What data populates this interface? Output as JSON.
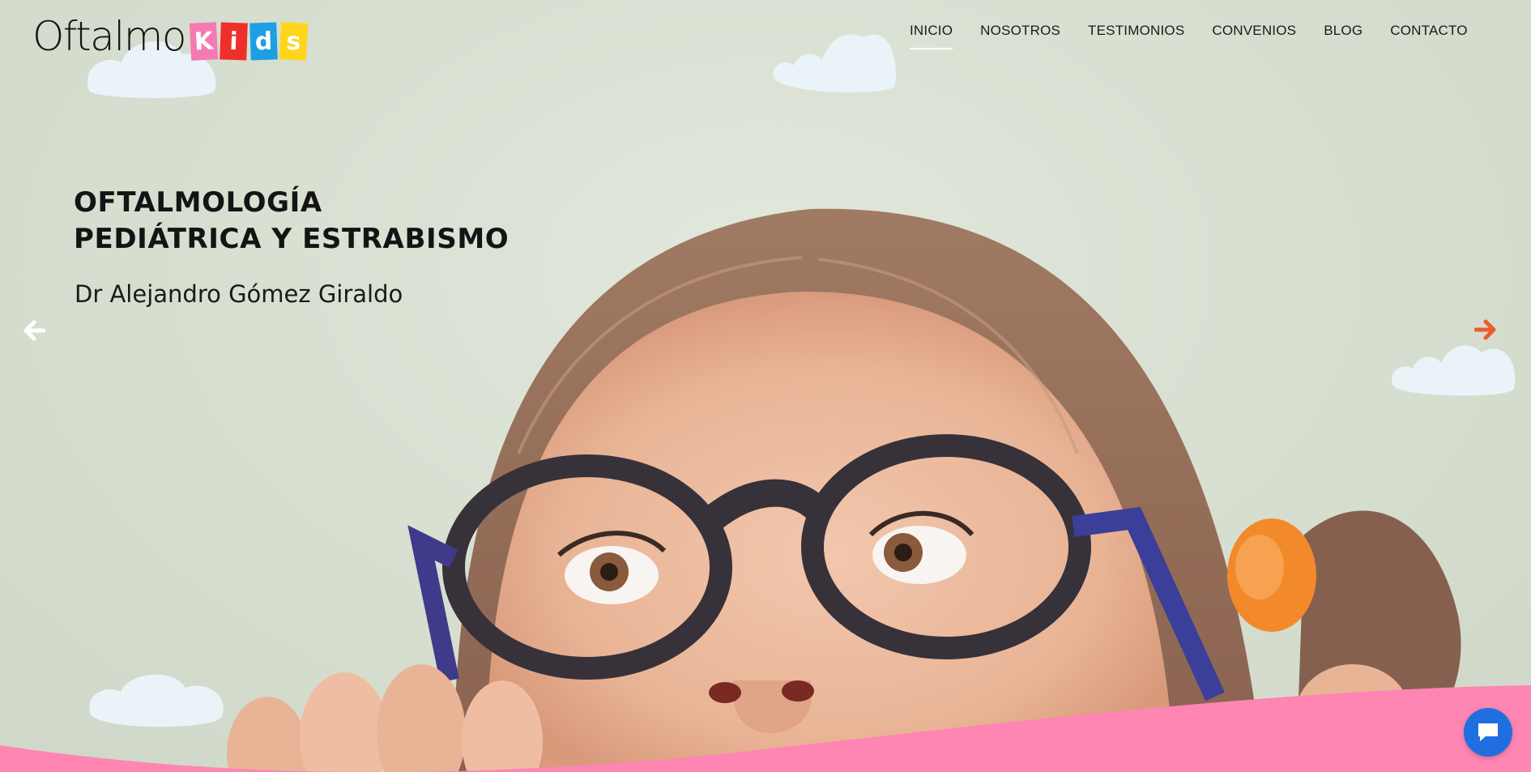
{
  "brand": {
    "word": "Oftalmo",
    "tiles": [
      {
        "letter": "K",
        "color": "#f47bb2"
      },
      {
        "letter": "i",
        "color": "#ee2f2c"
      },
      {
        "letter": "d",
        "color": "#1d9fe3"
      },
      {
        "letter": "s",
        "color": "#ffd51c"
      }
    ]
  },
  "nav": {
    "items": [
      {
        "label": "INICIO",
        "active": true
      },
      {
        "label": "NOSOTROS"
      },
      {
        "label": "TESTIMONIOS"
      },
      {
        "label": "CONVENIOS"
      },
      {
        "label": "BLOG"
      },
      {
        "label": "CONTACTO"
      }
    ]
  },
  "hero": {
    "headline_line1": "OFTALMOLOGÍA",
    "headline_line2": "PEDIÁTRICA Y ESTRABISMO",
    "subheadline": "Dr Alejandro Gómez Giraldo"
  },
  "slider": {
    "prev_icon": "arrow-left-icon",
    "next_icon": "arrow-right-icon",
    "prev_color": "#ffffff",
    "next_color": "#ef5a2c"
  },
  "chat": {
    "icon": "chat-bubble-icon",
    "color": "#1f6fe0"
  },
  "colors": {
    "wave": "#ff85b3",
    "cloud": "#eaf3f8"
  }
}
